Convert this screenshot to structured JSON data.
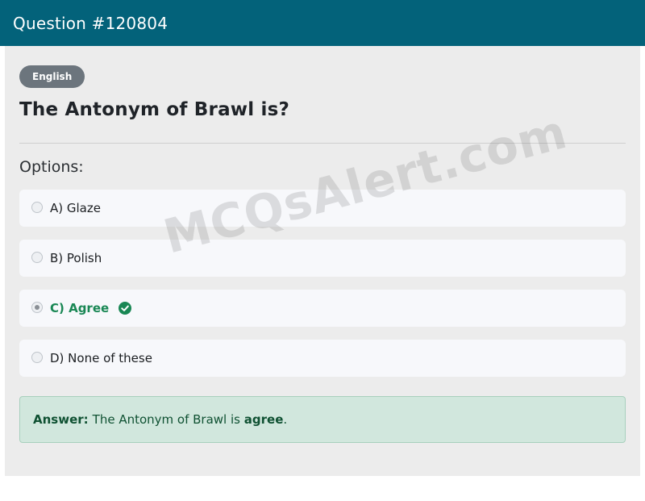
{
  "header": {
    "title": "Question #120804"
  },
  "question": {
    "language_badge": "English",
    "text": "The Antonym of Brawl is?"
  },
  "options_heading": "Options:",
  "options": [
    {
      "label": "A) Glaze",
      "selected": false,
      "correct": false
    },
    {
      "label": "B) Polish",
      "selected": false,
      "correct": false
    },
    {
      "label": "C) Agree",
      "selected": true,
      "correct": true,
      "icon": "check-circle-icon"
    },
    {
      "label": "D) None of these",
      "selected": false,
      "correct": false
    }
  ],
  "watermark": "MCQsAlert.com",
  "answer": {
    "label": "Answer:",
    "prefix": "The Antonym of Brawl is",
    "value": "agree",
    "suffix": "."
  },
  "colors": {
    "header_bg": "#03627a",
    "correct_green": "#198754",
    "answer_bg": "#d1e7dd",
    "badge_bg": "#6c757d"
  }
}
